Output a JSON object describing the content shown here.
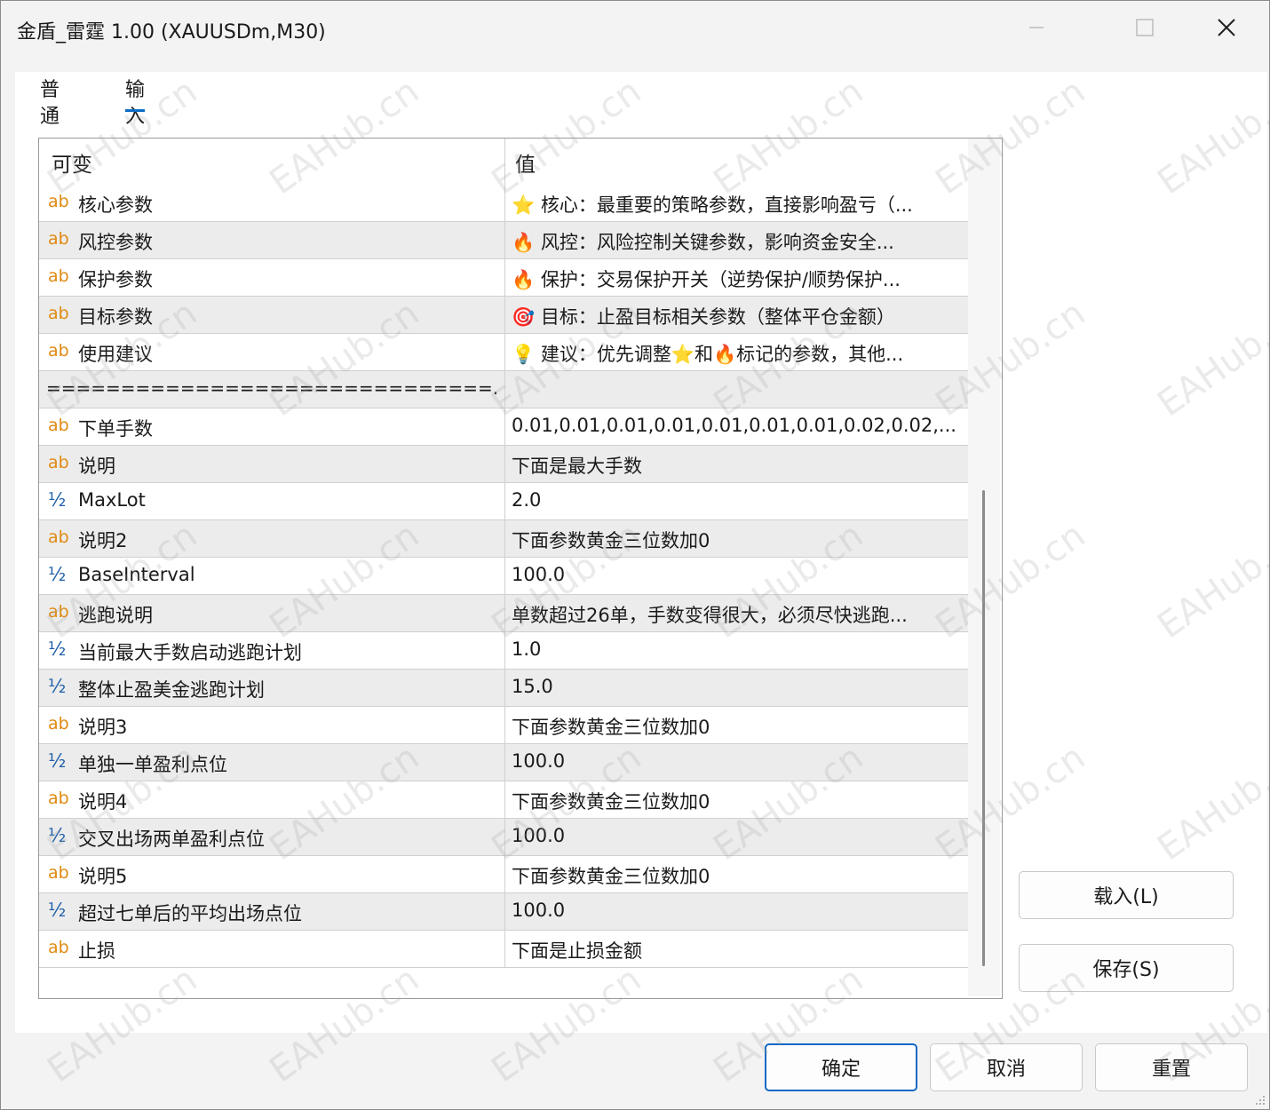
{
  "window": {
    "title": "金盾_雷霆 1.00 (XAUUSDm,M30)"
  },
  "tabs": [
    {
      "label": "普通",
      "active": false
    },
    {
      "label": "输入",
      "active": true
    }
  ],
  "grid": {
    "headers": {
      "variable": "可变",
      "value": "值"
    },
    "rows": [
      {
        "type": "ab",
        "name": "核心参数",
        "value": "⭐ 核心：最重要的策略参数，直接影响盈亏（..."
      },
      {
        "type": "ab",
        "name": "风控参数",
        "value": "🔥 风控：风险控制关键参数，影响资金安全..."
      },
      {
        "type": "ab",
        "name": "保护参数",
        "value": "🔥 保护：交易保护开关（逆势保护/顺势保护..."
      },
      {
        "type": "ab",
        "name": "目标参数",
        "value": "🎯 目标：止盈目标相关参数（整体平仓金额）"
      },
      {
        "type": "ab",
        "name": "使用建议",
        "value": "💡 建议：优先调整⭐和🔥标记的参数，其他..."
      },
      {
        "type": "sep",
        "name": "==============================...",
        "value": ""
      },
      {
        "type": "ab",
        "name": "下单手数",
        "value": "0.01,0.01,0.01,0.01,0.01,0.01,0.01,0.02,0.02,..."
      },
      {
        "type": "ab",
        "name": "说明",
        "value": "下面是最大手数"
      },
      {
        "type": "half",
        "name": "MaxLot",
        "value": "2.0"
      },
      {
        "type": "ab",
        "name": "说明2",
        "value": "下面参数黄金三位数加0"
      },
      {
        "type": "half",
        "name": "BaseInterval",
        "value": "100.0"
      },
      {
        "type": "ab",
        "name": "逃跑说明",
        "value": "单数超过26单，手数变得很大，必须尽快逃跑..."
      },
      {
        "type": "half",
        "name": "当前最大手数启动逃跑计划",
        "value": "1.0"
      },
      {
        "type": "half",
        "name": "整体止盈美金逃跑计划",
        "value": "15.0"
      },
      {
        "type": "ab",
        "name": "说明3",
        "value": "下面参数黄金三位数加0"
      },
      {
        "type": "half",
        "name": "单独一单盈利点位",
        "value": "100.0"
      },
      {
        "type": "ab",
        "name": "说明4",
        "value": "下面参数黄金三位数加0"
      },
      {
        "type": "half",
        "name": "交叉出场两单盈利点位",
        "value": "100.0"
      },
      {
        "type": "ab",
        "name": "说明5",
        "value": "下面参数黄金三位数加0"
      },
      {
        "type": "half",
        "name": "超过七单后的平均出场点位",
        "value": "100.0"
      },
      {
        "type": "ab",
        "name": "止损",
        "value": "下面是止损金额"
      }
    ],
    "icon_ab": "ab",
    "icon_half": "½"
  },
  "buttons": {
    "load": "载入(L)",
    "save": "保存(S)",
    "ok": "确定",
    "cancel": "取消",
    "reset": "重置"
  },
  "watermark": "EAHub.cn",
  "colors": {
    "accent": "#1368c4",
    "ab_icon": "#e08a12",
    "half_icon": "#1f5fa8",
    "alt_row": "#ececec"
  }
}
